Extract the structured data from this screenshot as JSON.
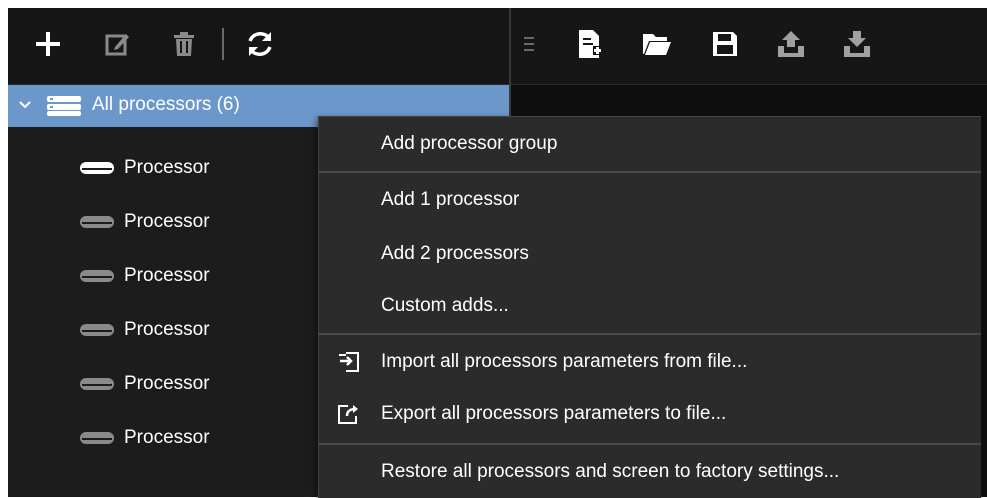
{
  "toolbar_left": {
    "buttons": [
      {
        "icon": "plus-icon"
      },
      {
        "icon": "edit-icon"
      },
      {
        "icon": "trash-icon"
      },
      {
        "icon": "refresh-icon"
      }
    ]
  },
  "toolbar_right": {
    "buttons": [
      {
        "icon": "drag-handle-icon"
      },
      {
        "icon": "new-file-icon"
      },
      {
        "icon": "open-folder-icon"
      },
      {
        "icon": "save-icon"
      },
      {
        "icon": "upload-icon"
      },
      {
        "icon": "download-icon"
      }
    ]
  },
  "tree": {
    "root_label": "All processors (6)",
    "items": [
      {
        "label": "Processor"
      },
      {
        "label": "Processor"
      },
      {
        "label": "Processor"
      },
      {
        "label": "Processor"
      },
      {
        "label": "Processor"
      },
      {
        "label": "Processor"
      }
    ]
  },
  "menu": {
    "add_group": "Add processor group",
    "add_1": "Add 1 processor",
    "add_2": "Add 2 processors",
    "custom": "Custom adds...",
    "import": "Import all processors parameters from file...",
    "export": "Export all processors parameters to file...",
    "restore": "Restore all processors and screen to factory settings..."
  },
  "colors": {
    "selection": "#6b97cb",
    "background": "#1c1c1c",
    "menu_background": "#2b2b2b"
  }
}
